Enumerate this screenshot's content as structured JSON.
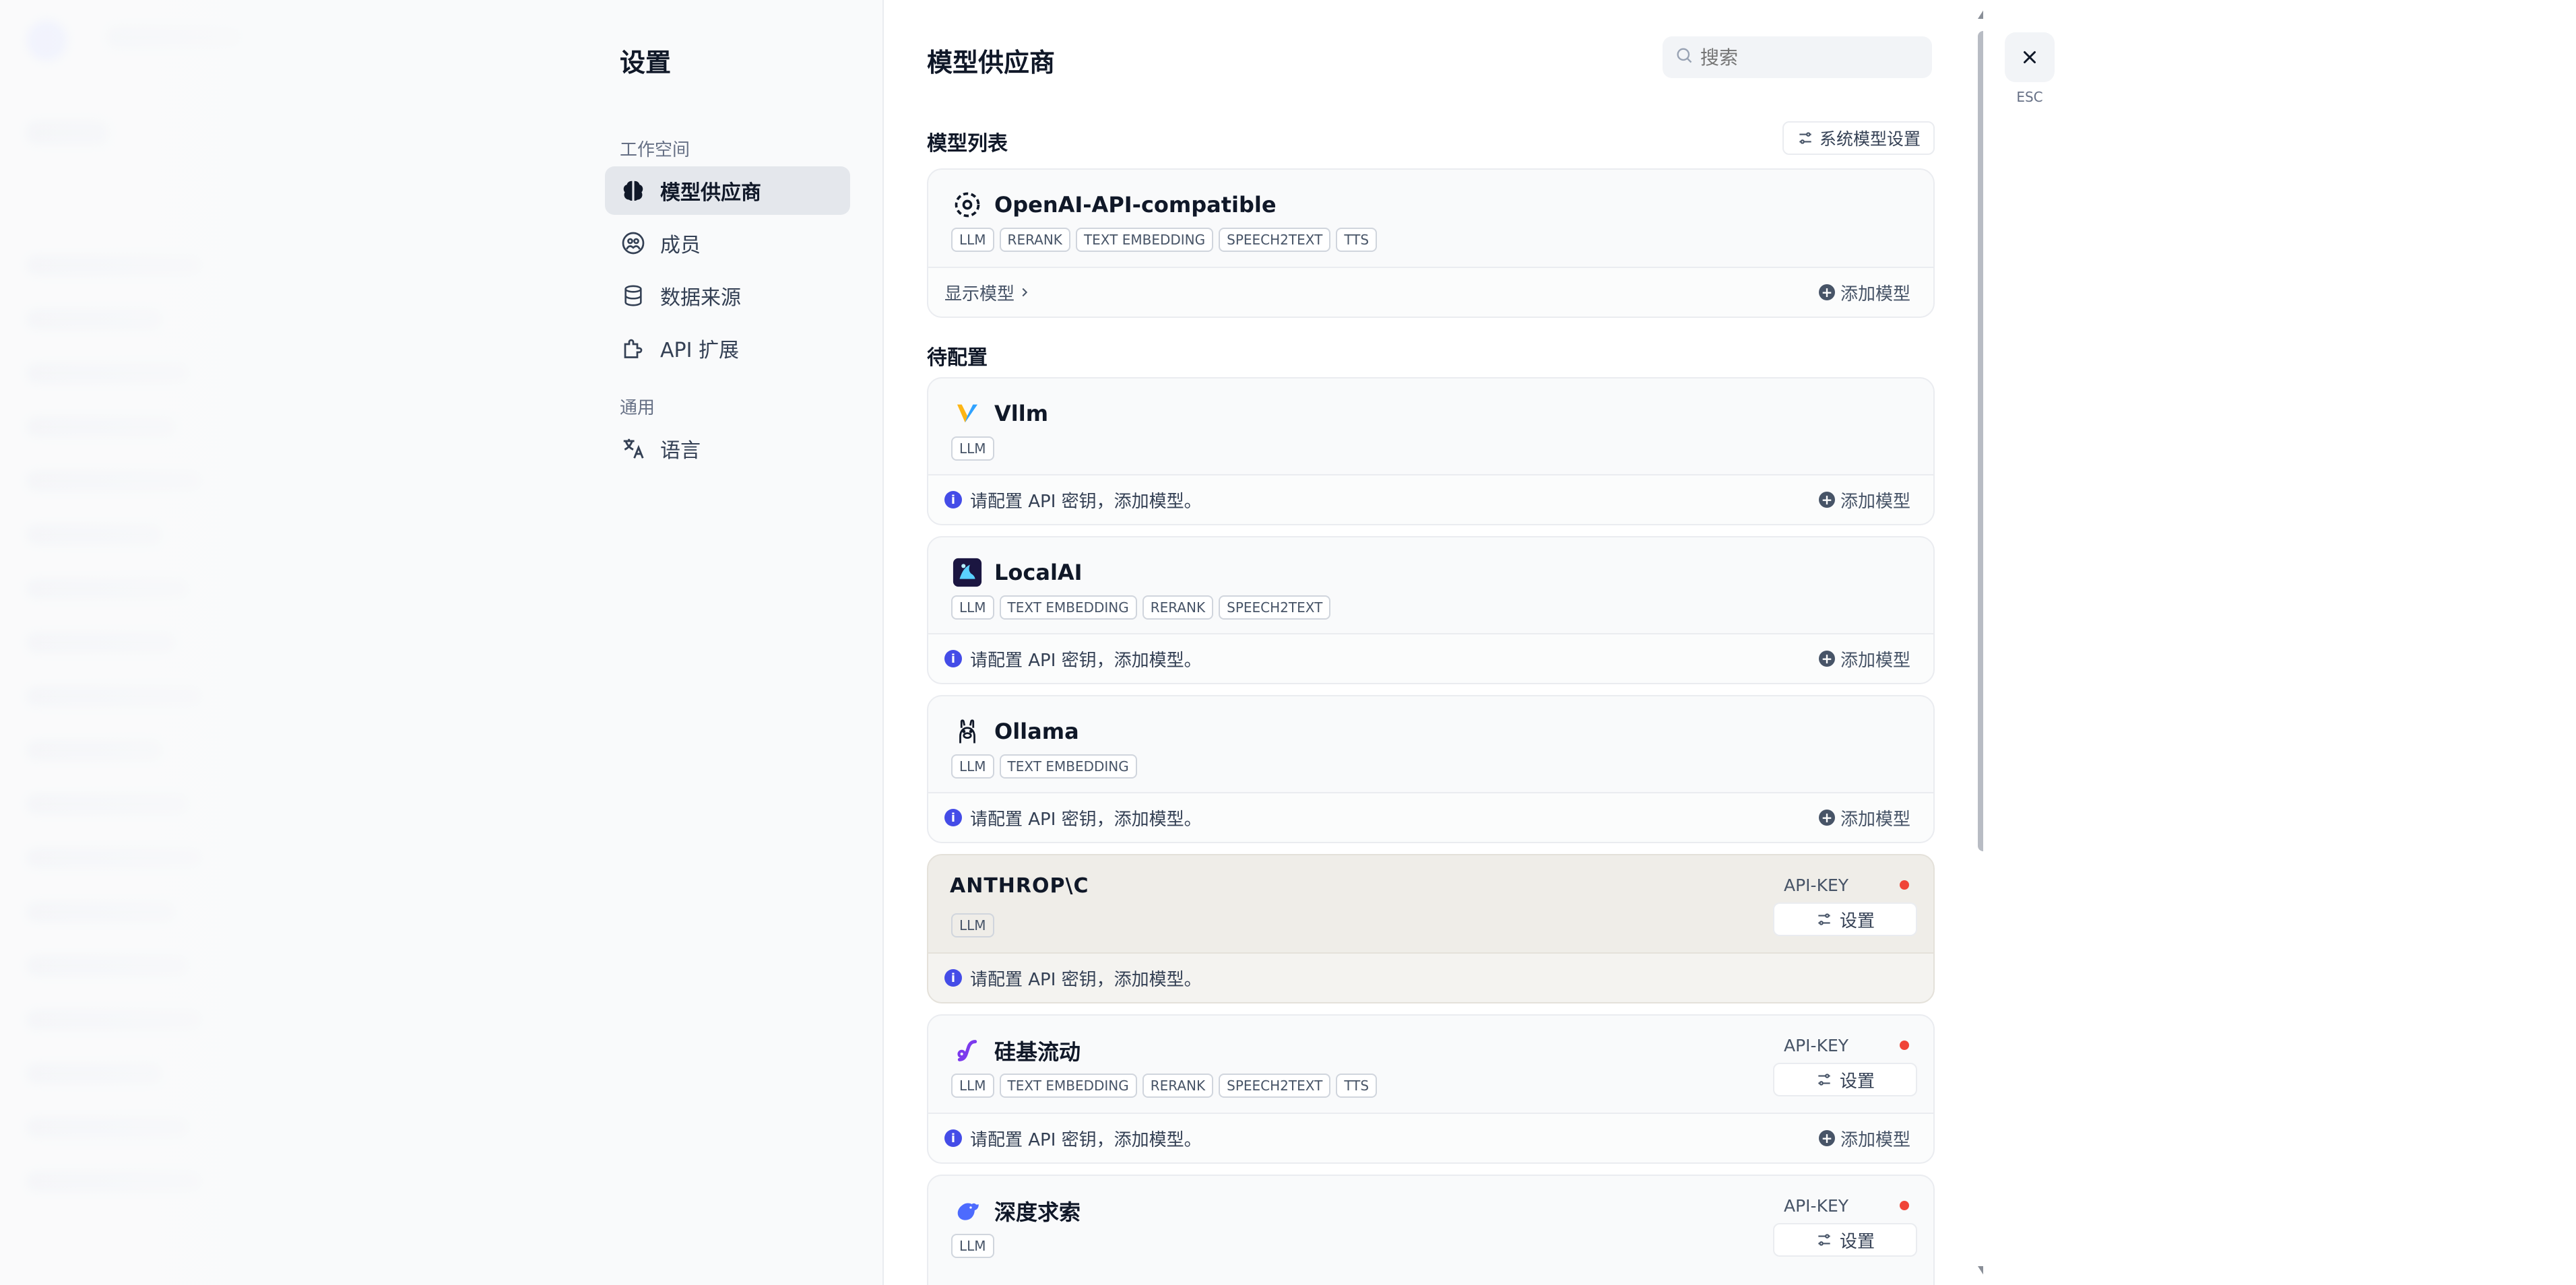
{
  "settings": {
    "title": "设置",
    "workspace_group": "工作空间",
    "general_group": "通用",
    "nav": [
      {
        "label": "模型供应商",
        "icon": "brain-icon"
      },
      {
        "label": "成员",
        "icon": "members-icon"
      },
      {
        "label": "数据来源",
        "icon": "database-icon"
      },
      {
        "label": "API 扩展",
        "icon": "puzzle-icon"
      },
      {
        "label": "语言",
        "icon": "translate-icon"
      }
    ]
  },
  "main": {
    "title": "模型供应商",
    "search_placeholder": "搜索",
    "model_list_label": "模型列表",
    "system_settings_label": "系统模型设置",
    "pending_label": "待配置"
  },
  "configured": {
    "name": "OpenAI-API-compatible",
    "tags": [
      "LLM",
      "RERANK",
      "TEXT EMBEDDING",
      "SPEECH2TEXT",
      "TTS"
    ],
    "show_models": "显示模型",
    "add_model": "添加模型"
  },
  "providers": [
    {
      "name": "Vllm",
      "tags": [
        "LLM"
      ],
      "notice": "请配置 API 密钥，添加模型。",
      "add_model": "添加模型"
    },
    {
      "name": "LocalAI",
      "tags": [
        "LLM",
        "TEXT EMBEDDING",
        "RERANK",
        "SPEECH2TEXT"
      ],
      "notice": "请配置 API 密钥，添加模型。",
      "add_model": "添加模型"
    },
    {
      "name": "Ollama",
      "tags": [
        "LLM",
        "TEXT EMBEDDING"
      ],
      "notice": "请配置 API 密钥，添加模型。",
      "add_model": "添加模型"
    },
    {
      "name": "ANTHROP\\C",
      "tags": [
        "LLM"
      ],
      "notice": "请配置 API 密钥，添加模型。",
      "api_key": "API-KEY",
      "settings": "设置"
    },
    {
      "name": "硅基流动",
      "tags": [
        "LLM",
        "TEXT EMBEDDING",
        "RERANK",
        "SPEECH2TEXT",
        "TTS"
      ],
      "notice": "请配置 API 密钥，添加模型。",
      "add_model": "添加模型",
      "api_key": "API-KEY",
      "settings": "设置"
    },
    {
      "name": "深度求索",
      "tags": [
        "LLM"
      ],
      "api_key": "API-KEY",
      "settings": "设置"
    }
  ],
  "close": {
    "esc": "ESC"
  },
  "colors": {
    "accent": "#444ce7",
    "status_error": "#f04438",
    "anthropic_bg": "#efede8"
  }
}
